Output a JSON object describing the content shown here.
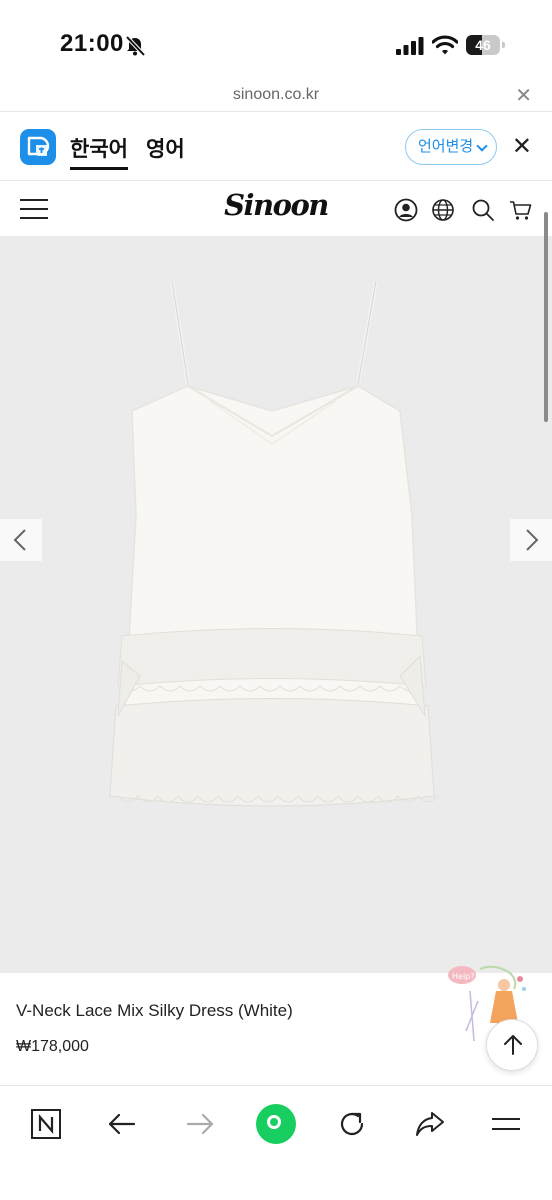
{
  "status_bar": {
    "time": "21:00",
    "battery_text": "46",
    "battery_level": 0.46
  },
  "url_bar": {
    "domain": "sinoon.co.kr",
    "close_icon": "close-icon"
  },
  "translate_bar": {
    "languages": [
      "한국어",
      "영어"
    ],
    "active_language_index": 0,
    "change_language_label": "언어변경",
    "accent_color": "#1e8fe8"
  },
  "header": {
    "logo_text": "Sinoon",
    "icons": [
      "menu-icon",
      "account-icon",
      "globe-icon",
      "search-icon",
      "cart-icon"
    ]
  },
  "gallery": {
    "background_color": "#ebebeb",
    "prev_icon": "chevron-left-icon",
    "next_icon": "chevron-right-icon"
  },
  "product": {
    "name": "V-Neck Lace Mix Silky Dress (White)",
    "price": "₩178,000",
    "help_label": "Help?"
  },
  "bottom_bar": {
    "icons": [
      "naver-icon",
      "back-arrow-icon",
      "forward-arrow-icon",
      "home-icon",
      "reload-icon",
      "share-icon",
      "menu-icon"
    ],
    "home_color": "#19ce60"
  }
}
